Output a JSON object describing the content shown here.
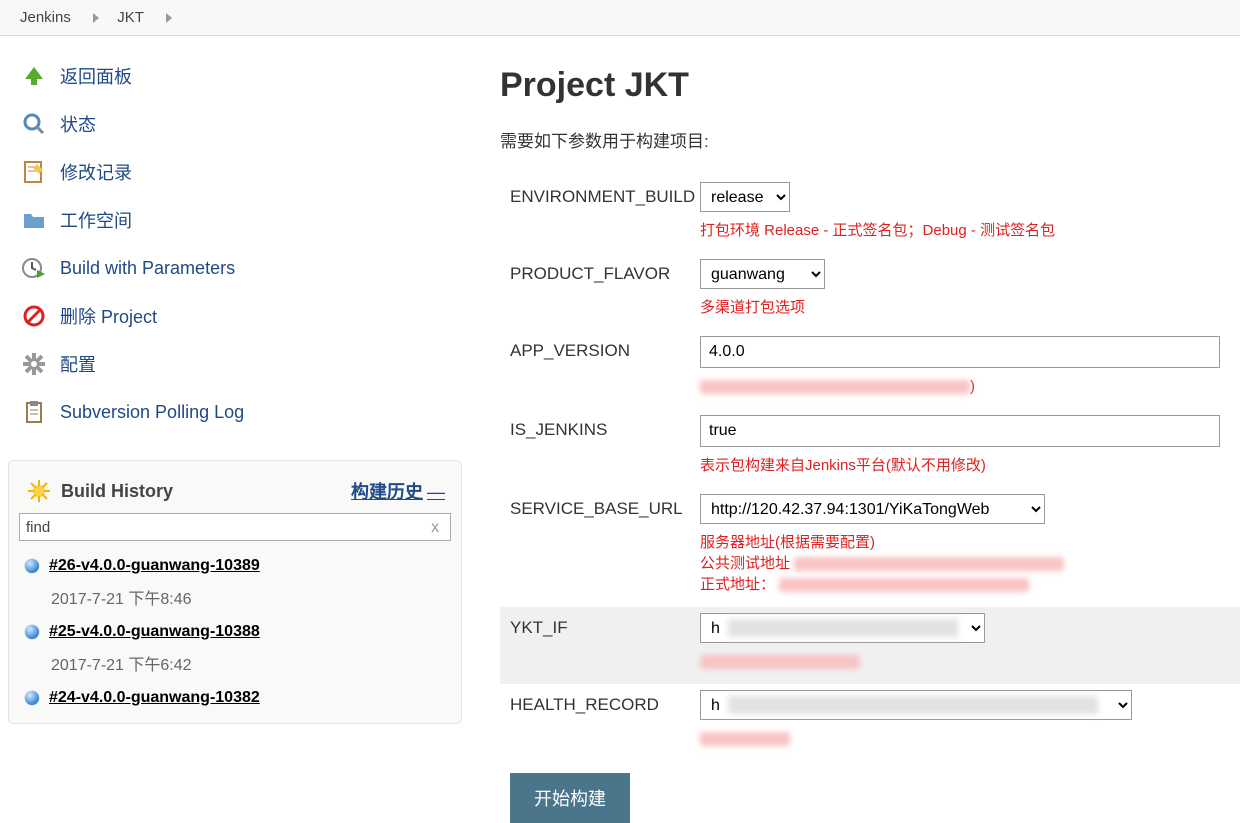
{
  "breadcrumb": {
    "root": "Jenkins",
    "project": "JKT"
  },
  "sidebar": {
    "items": [
      {
        "label": "返回面板"
      },
      {
        "label": "状态"
      },
      {
        "label": "修改记录"
      },
      {
        "label": "工作空间"
      },
      {
        "label": "Build with Parameters"
      },
      {
        "label": "删除 Project"
      },
      {
        "label": "配置"
      },
      {
        "label": "Subversion Polling Log"
      }
    ]
  },
  "history": {
    "title": "Build History",
    "trend_label": "构建历史",
    "search_value": "find",
    "builds": [
      {
        "name": "#26-v4.0.0-guanwang-10389",
        "time": "2017-7-21 下午8:46"
      },
      {
        "name": "#25-v4.0.0-guanwang-10388",
        "time": "2017-7-21 下午6:42"
      },
      {
        "name": "#24-v4.0.0-guanwang-10382",
        "time": ""
      }
    ]
  },
  "main": {
    "title": "Project JKT",
    "intro": "需要如下参数用于构建项目:",
    "params": {
      "env": {
        "label": "ENVIRONMENT_BUILD",
        "value": "release",
        "help": "打包环境 Release - 正式签名包；Debug - 测试签名包"
      },
      "flavor": {
        "label": "PRODUCT_FLAVOR",
        "value": "guanwang",
        "help": "多渠道打包选项"
      },
      "ver": {
        "label": "APP_VERSION",
        "value": "4.0.0"
      },
      "isj": {
        "label": "IS_JENKINS",
        "value": "true",
        "help": "表示包构建来自Jenkins平台(默认不用修改)"
      },
      "url": {
        "label": "SERVICE_BASE_URL",
        "value": "http://120.42.37.94:1301/YiKaTongWeb",
        "help1": "服务器地址(根据需要配置)",
        "help2": "公共测试地址",
        "help3": "正式地址："
      },
      "ykt": {
        "label": "YKT_IF"
      },
      "health": {
        "label": "HEALTH_RECORD"
      }
    },
    "build_btn": "开始构建"
  }
}
